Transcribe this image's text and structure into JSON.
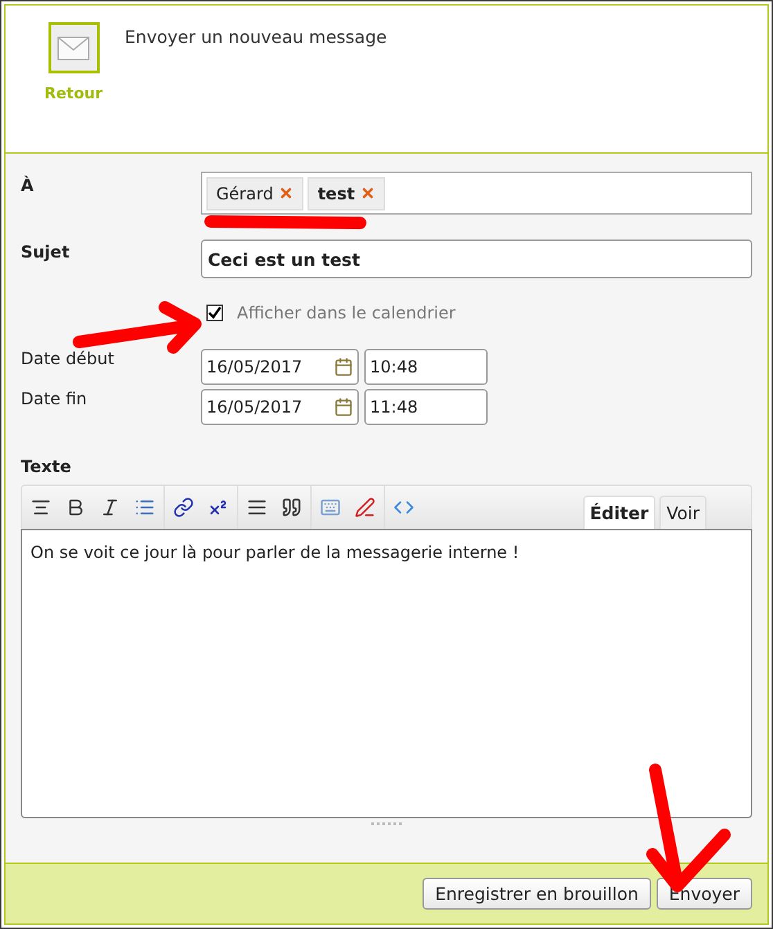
{
  "header": {
    "title": "Envoyer un nouveau message",
    "back_label": "Retour"
  },
  "form": {
    "to": {
      "label": "À",
      "recipients": [
        {
          "name": "Gérard",
          "emphasized": false
        },
        {
          "name": "test",
          "emphasized": true
        }
      ]
    },
    "subject": {
      "label": "Sujet",
      "value": "Ceci est un test"
    },
    "show_in_calendar": {
      "label": "Afficher dans le calendrier",
      "checked": true
    },
    "dates": [
      {
        "label": "Date début",
        "date": "16/05/2017",
        "time": "10:48"
      },
      {
        "label": "Date fin",
        "date": "16/05/2017",
        "time": "11:48"
      }
    ],
    "text": {
      "label": "Texte",
      "value": "On se voit ce jour là pour parler de la messagerie interne !"
    }
  },
  "editor_tabs": [
    {
      "label": "Éditer",
      "selected": true
    },
    {
      "label": "Voir",
      "selected": false
    }
  ],
  "buttons": [
    {
      "label": "Enregistrer en brouillon"
    },
    {
      "label": "Envoyer"
    }
  ]
}
